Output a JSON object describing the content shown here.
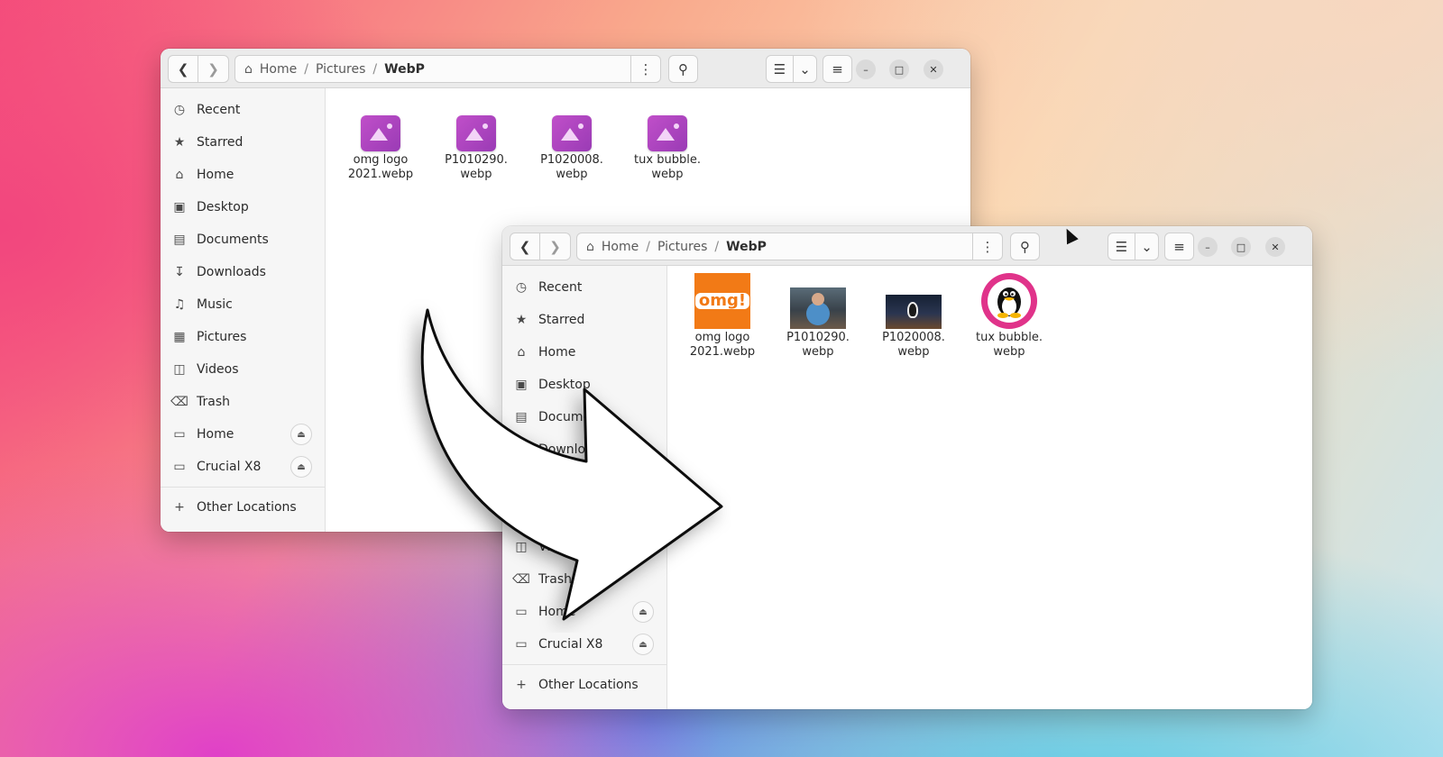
{
  "path": {
    "home": "Home",
    "sep": "/",
    "pictures": "Pictures",
    "current": "WebP"
  },
  "sidebar": {
    "items": [
      {
        "label": "Recent",
        "icon": "clock-icon"
      },
      {
        "label": "Starred",
        "icon": "star-icon"
      },
      {
        "label": "Home",
        "icon": "home-icon"
      },
      {
        "label": "Desktop",
        "icon": "desktop-icon"
      },
      {
        "label": "Documents",
        "icon": "document-icon"
      },
      {
        "label": "Downloads",
        "icon": "download-icon"
      },
      {
        "label": "Music",
        "icon": "music-icon"
      },
      {
        "label": "Pictures",
        "icon": "image-icon"
      },
      {
        "label": "Videos",
        "icon": "video-icon"
      },
      {
        "label": "Trash",
        "icon": "trash-icon"
      }
    ],
    "drives": [
      {
        "label": "Home",
        "icon": "drive-icon"
      },
      {
        "label": "Crucial X8",
        "icon": "drive-icon"
      }
    ],
    "other": "Other Locations"
  },
  "files": [
    {
      "line1": "omg logo",
      "line2": "2021.webp"
    },
    {
      "line1": "P1010290.",
      "line2": "webp"
    },
    {
      "line1": "P1020008.",
      "line2": "webp"
    },
    {
      "line1": "tux bubble.",
      "line2": "webp"
    }
  ],
  "omg_text": "omg!",
  "colors": {
    "generic_thumb": "#b445c2",
    "omg_orange": "#f27a16",
    "tux_pink": "#e0338a"
  }
}
